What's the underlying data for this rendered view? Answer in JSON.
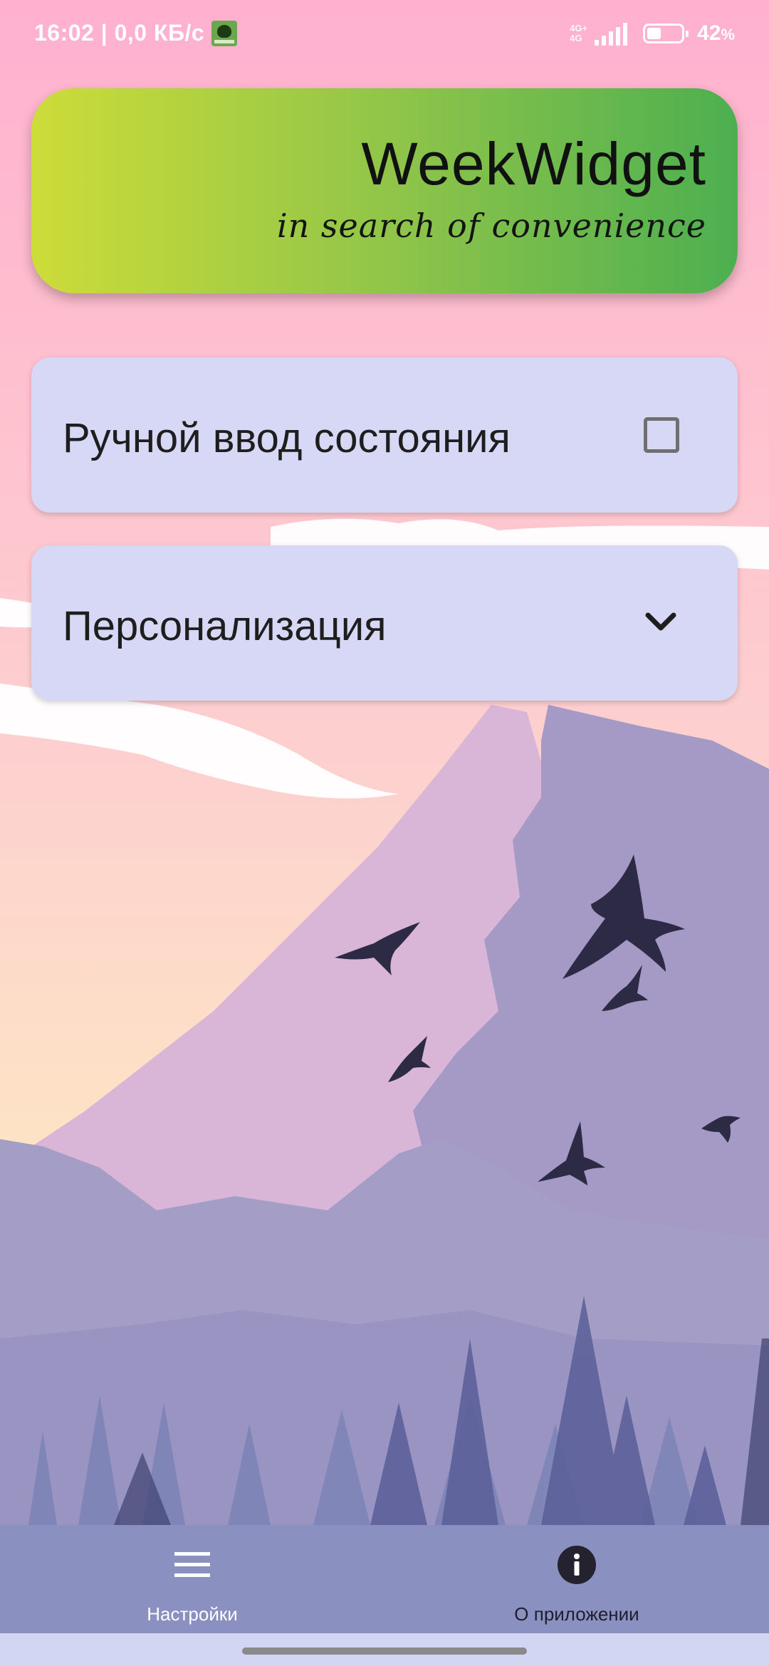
{
  "status_bar": {
    "time_and_speed": "16:02 | 0,0 КБ/с",
    "network_type": "4G+",
    "network_type_secondary": "4G",
    "battery_level": 0.42,
    "battery_percent": "42",
    "battery_percent_sign": "%",
    "notification_icon": "app-notification-icon"
  },
  "header": {
    "title": "WeekWidget",
    "subtitle": "in search of convenience",
    "gradient_start": "#cddc39",
    "gradient_end": "#4caf50"
  },
  "settings": {
    "manual_state": {
      "label": "Ручной ввод состояния",
      "checked": false,
      "icon": "checkbox-icon"
    },
    "personalization": {
      "label": "Персонализация",
      "icon": "chevron-down-icon"
    }
  },
  "bottom_nav": {
    "items": [
      {
        "label": "Настройки",
        "icon": "menu-icon",
        "active": true
      },
      {
        "label": "О приложении",
        "icon": "info-icon",
        "active": false
      }
    ]
  },
  "colors": {
    "card_background": "#d6d8f5",
    "nav_background": "#8a90bf",
    "sky_top": "#ffb0cf",
    "sky_bottom": "#fde8c2",
    "mountain_light": "#d9b6d8",
    "mountain_dark": "#a59ac6",
    "birds": "#2c2a45"
  }
}
